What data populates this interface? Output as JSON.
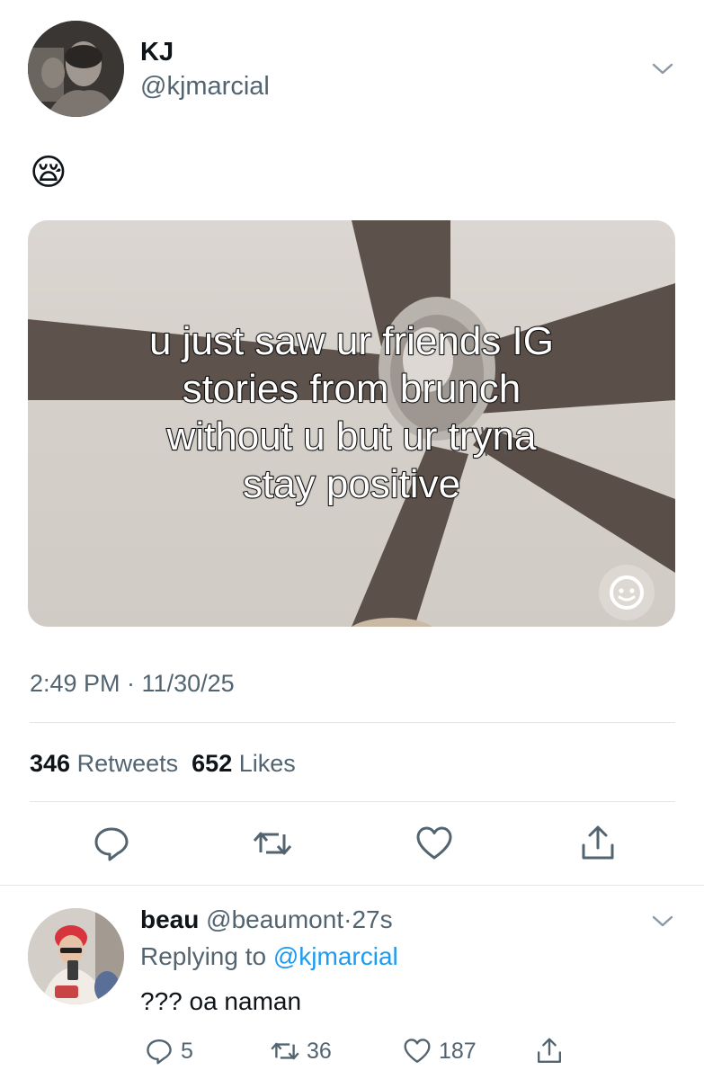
{
  "tweet": {
    "author_name": "KJ",
    "author_handle": "@kjmarcial",
    "text": "😪",
    "media": {
      "caption_lines": [
        "u just saw ur friends IG",
        "stories from brunch",
        "without u but ur tryna",
        "stay positive"
      ],
      "sticker_icon": "smiley-icon"
    },
    "timestamp": "2:49 PM · 11/30/25",
    "retweets_count": "346",
    "retweets_label": "Retweets",
    "likes_count": "652",
    "likes_label": "Likes",
    "actions": [
      "reply-icon",
      "retweet-icon",
      "like-icon",
      "share-icon"
    ]
  },
  "reply": {
    "author_name": "beau",
    "author_handle": "@beaumont",
    "separator": "·",
    "time": "27s",
    "replying_prefix": "Replying to",
    "replying_to": "@kjmarcial",
    "text": "??? oa naman",
    "reply_count": "5",
    "retweet_count": "36",
    "like_count": "187"
  },
  "colors": {
    "text_primary": "#0f1419",
    "text_secondary": "#536471",
    "link": "#1d9bf0",
    "divider": "#e1e6ea"
  }
}
